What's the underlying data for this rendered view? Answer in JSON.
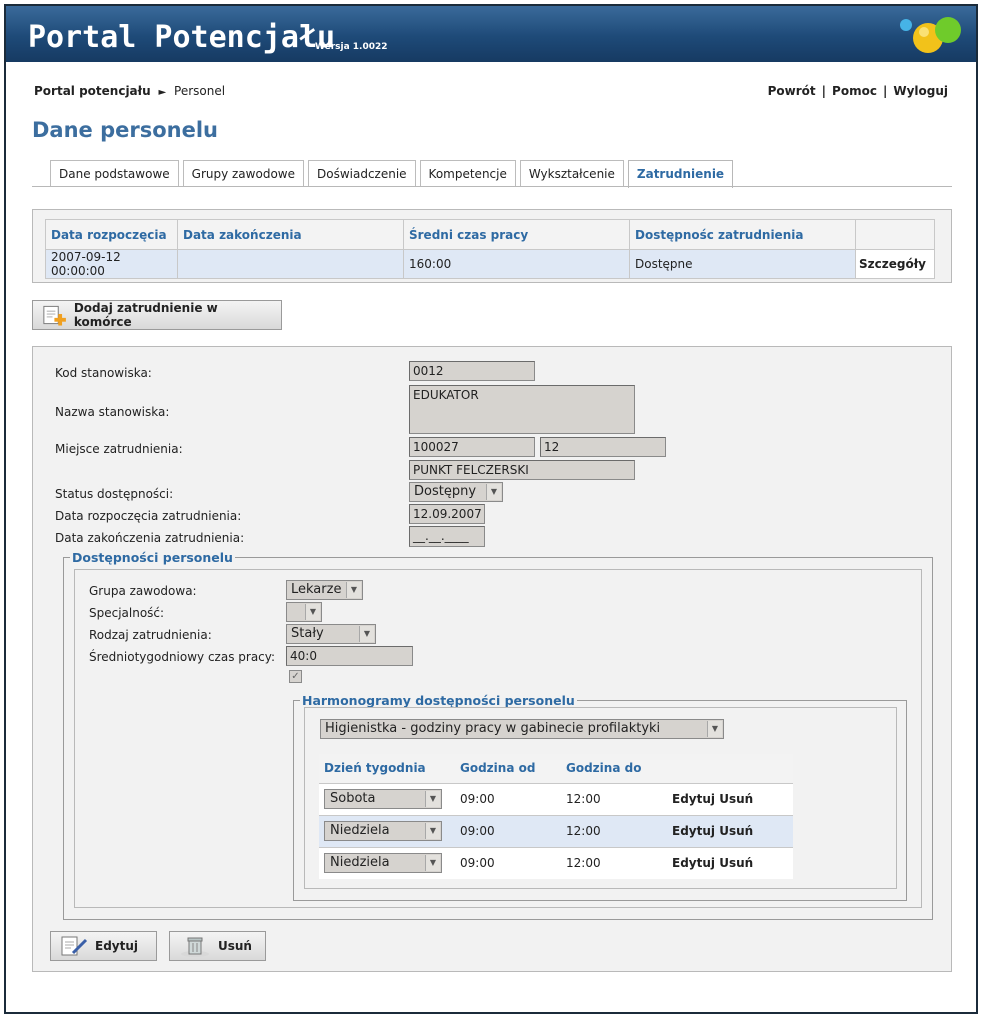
{
  "app": {
    "title": "Portal Potencjału",
    "version": "Wersja 1.0022"
  },
  "breadcrumb": {
    "root": "Portal potencjału",
    "separator": "►",
    "current": "Personel"
  },
  "topnav": {
    "back": "Powrót",
    "help": "Pomoc",
    "logout": "Wyloguj",
    "pipe": "|"
  },
  "page_title": "Dane personelu",
  "tabs": [
    {
      "label": "Dane podstawowe"
    },
    {
      "label": "Grupy zawodowe"
    },
    {
      "label": "Doświadczenie"
    },
    {
      "label": "Kompetencje"
    },
    {
      "label": "Wykształcenie"
    },
    {
      "label": "Zatrudnienie",
      "active": true
    }
  ],
  "employment_table": {
    "headers": [
      "Data rozpoczęcia",
      "Data zakończenia",
      "Średni czas pracy",
      "Dostępnośc zatrudnienia",
      ""
    ],
    "rows": [
      {
        "start": "2007-09-12 00:00:00",
        "end": "",
        "avg_time": "160:00",
        "availability": "Dostępne",
        "details": "Szczegóły"
      }
    ]
  },
  "add_button": {
    "label": "Dodaj zatrudnienie w komórce"
  },
  "form": {
    "code_label": "Kod stanowiska:",
    "code_value": "0012",
    "name_label": "Nazwa stanowiska:",
    "name_value": "EDUKATOR",
    "place_label": "Miejsce zatrudnienia:",
    "place_value1": "100027",
    "place_value2": "12",
    "place_value3": "PUNKT FELCZERSKI",
    "status_label": "Status dostępności:",
    "status_value": "Dostępny",
    "start_label": "Data rozpoczęcia zatrudnienia:",
    "start_value": "12.09.2007",
    "end_label": "Data zakończenia zatrudnienia:",
    "end_value": "__.__.____"
  },
  "availability": {
    "legend": "Dostępności personelu",
    "group_label": "Grupa zawodowa:",
    "group_value": "Lekarze",
    "spec_label": "Specjalność:",
    "spec_value": "",
    "type_label": "Rodzaj zatrudnienia:",
    "type_value": "Stały",
    "weekly_label": "Średniotygodniowy czas pracy:",
    "weekly_value": "40:0",
    "checkbox_mark": "✓"
  },
  "schedules": {
    "legend": "Harmonogramy dostępności personelu",
    "selected": "Higienistka - godziny pracy w gabinecie profilaktyki",
    "headers": [
      "Dzień tygodnia",
      "Godzina od",
      "Godzina do",
      ""
    ],
    "rows": [
      {
        "day": "Sobota",
        "from": "09:00",
        "to": "12:00",
        "edit": "Edytuj",
        "delete": "Usuń"
      },
      {
        "day": "Niedziela",
        "from": "09:00",
        "to": "12:00",
        "edit": "Edytuj",
        "delete": "Usuń"
      },
      {
        "day": "Niedziela",
        "from": "09:00",
        "to": "12:00",
        "edit": "Edytuj",
        "delete": "Usuń"
      }
    ]
  },
  "bottom_buttons": {
    "edit": "Edytuj",
    "delete": "Usuń"
  },
  "icons": {
    "add": "add-document-icon",
    "edit": "edit-pencil-icon",
    "delete": "trash-icon",
    "dropdown": "chevron-down-icon",
    "logo": "colored-balls-logo"
  }
}
